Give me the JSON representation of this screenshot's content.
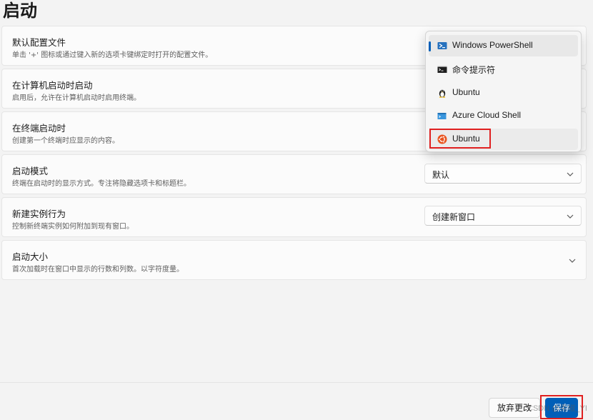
{
  "page": {
    "title": "启动"
  },
  "settings": [
    {
      "title": "默认配置文件",
      "description": "单击 '+' 图标或通过键入新的选项卡键绑定时打开的配置文件。"
    },
    {
      "title": "在计算机启动时启动",
      "description": "启用后，允许在计算机启动时启用终端。"
    },
    {
      "title": "在终端启动时",
      "description": "创建第一个终端时应显示的内容。"
    },
    {
      "title": "启动模式",
      "description": "终端在启动时的显示方式。专注将隐藏选项卡和标题栏。",
      "value": "默认"
    },
    {
      "title": "新建实例行为",
      "description": "控制新终端实例如何附加到现有窗口。",
      "value": "创建新窗口"
    },
    {
      "title": "启动大小",
      "description": "首次加载时在窗口中显示的行数和列数。以字符度量。"
    }
  ],
  "profile_dropdown": {
    "items": [
      {
        "label": "Windows PowerShell",
        "icon": "powershell-icon"
      },
      {
        "label": "命令提示符",
        "icon": "cmd-icon"
      },
      {
        "label": "Ubuntu",
        "icon": "linux-tux-icon"
      },
      {
        "label": "Azure Cloud Shell",
        "icon": "azure-icon"
      },
      {
        "label": "Ubuntu",
        "icon": "ubuntu-icon"
      }
    ]
  },
  "footer": {
    "discard_label": "放弃更改",
    "save_label": "保存",
    "watermark": "CSDN @青椒_YI"
  },
  "colors": {
    "accent": "#005fb8",
    "highlight": "#e02020",
    "ubuntu_orange": "#e95420"
  }
}
